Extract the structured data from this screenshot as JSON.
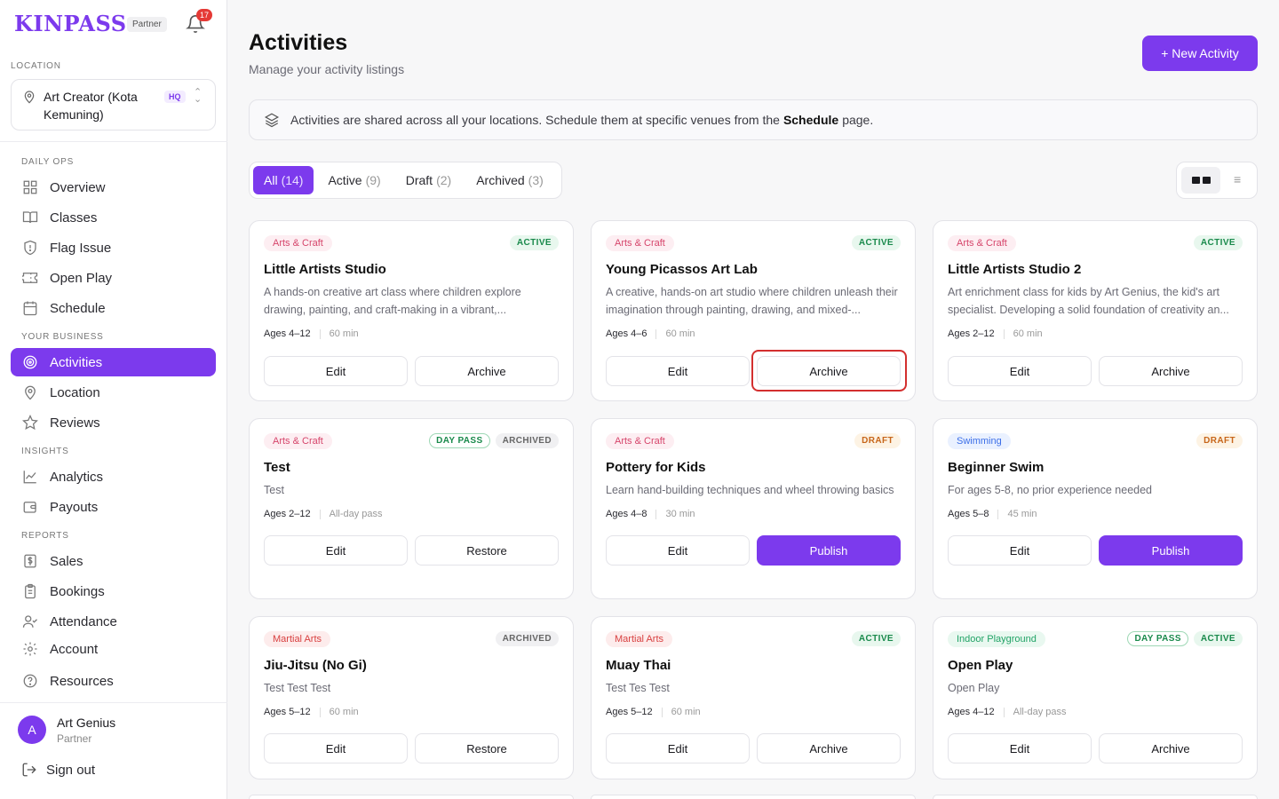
{
  "brand": "KINPASS",
  "partner_label": "Partner",
  "notifications_count": "17",
  "location": {
    "section_label": "LOCATION",
    "name": "Art Creator (Kota Kemuning)",
    "hq": "HQ"
  },
  "nav": {
    "daily_ops": "DAILY OPS",
    "overview": "Overview",
    "classes": "Classes",
    "flag_issue": "Flag Issue",
    "open_play": "Open Play",
    "schedule": "Schedule",
    "your_business": "YOUR BUSINESS",
    "activities": "Activities",
    "location": "Location",
    "reviews": "Reviews",
    "insights": "INSIGHTS",
    "analytics": "Analytics",
    "payouts": "Payouts",
    "reports": "REPORTS",
    "sales": "Sales",
    "bookings": "Bookings",
    "attendance": "Attendance",
    "account": "Account",
    "resources": "Resources"
  },
  "user": {
    "initial": "A",
    "name": "Art Genius",
    "role": "Partner"
  },
  "sign_out": "Sign out",
  "header": {
    "title": "Activities",
    "subtitle": "Manage your activity listings",
    "new_button": "+ New Activity"
  },
  "banner": {
    "text_before": "Activities are shared across all your locations. Schedule them at specific venues from the",
    "link": "Schedule",
    "text_after": "page."
  },
  "tabs": [
    {
      "label": "All",
      "count": "(14)"
    },
    {
      "label": "Active",
      "count": "(9)"
    },
    {
      "label": "Draft",
      "count": "(2)"
    },
    {
      "label": "Archived",
      "count": "(3)"
    }
  ],
  "view_toggle": {
    "list_glyph": "≡"
  },
  "cards": [
    {
      "category": "Arts & Craft",
      "badges": [
        "ACTIVE"
      ],
      "title": "Little Artists Studio",
      "desc": "A hands-on creative art class where children explore drawing, painting, and craft-making in a vibrant,...",
      "ages": "Ages 4–12",
      "duration": "60 min",
      "edit": "Edit",
      "action": "Archive"
    },
    {
      "category": "Arts & Craft",
      "badges": [
        "ACTIVE"
      ],
      "title": "Young Picassos Art Lab",
      "desc": "A creative, hands-on art studio where children unleash their imagination through painting, drawing, and mixed-...",
      "ages": "Ages 4–6",
      "duration": "60 min",
      "edit": "Edit",
      "action": "Archive"
    },
    {
      "category": "Arts & Craft",
      "badges": [
        "ACTIVE"
      ],
      "title": "Little Artists Studio 2",
      "desc": "Art enrichment class for kids by Art Genius, the kid's art specialist. Developing a solid foundation of creativity an...",
      "ages": "Ages 2–12",
      "duration": "60 min",
      "edit": "Edit",
      "action": "Archive"
    },
    {
      "category": "Arts & Craft",
      "badges": [
        "DAY PASS",
        "ARCHIVED"
      ],
      "title": "Test",
      "desc": "Test",
      "ages": "Ages 2–12",
      "duration": "All-day pass",
      "edit": "Edit",
      "action": "Restore"
    },
    {
      "category": "Arts & Craft",
      "badges": [
        "DRAFT"
      ],
      "title": "Pottery for Kids",
      "desc": "Learn hand-building techniques and wheel throwing basics",
      "ages": "Ages 4–8",
      "duration": "30 min",
      "edit": "Edit",
      "action": "Publish"
    },
    {
      "category": "Swimming",
      "badges": [
        "DRAFT"
      ],
      "title": "Beginner Swim",
      "desc": "For ages 5-8, no prior experience needed",
      "ages": "Ages 5–8",
      "duration": "45 min",
      "edit": "Edit",
      "action": "Publish"
    },
    {
      "category": "Martial Arts",
      "badges": [
        "ARCHIVED"
      ],
      "title": "Jiu-Jitsu (No Gi)",
      "desc": "Test Test Test",
      "ages": "Ages 5–12",
      "duration": "60 min",
      "edit": "Edit",
      "action": "Restore"
    },
    {
      "category": "Martial Arts",
      "badges": [
        "ACTIVE"
      ],
      "title": "Muay Thai",
      "desc": "Test Tes Test",
      "ages": "Ages 5–12",
      "duration": "60 min",
      "edit": "Edit",
      "action": "Archive"
    },
    {
      "category": "Indoor Playground",
      "badges": [
        "DAY PASS",
        "ACTIVE"
      ],
      "title": "Open Play",
      "desc": "Open Play",
      "ages": "Ages 4–12",
      "duration": "All-day pass",
      "edit": "Edit",
      "action": "Archive"
    }
  ],
  "colors": {
    "accent": "#7c3aed",
    "highlight": "#d32f2f"
  }
}
